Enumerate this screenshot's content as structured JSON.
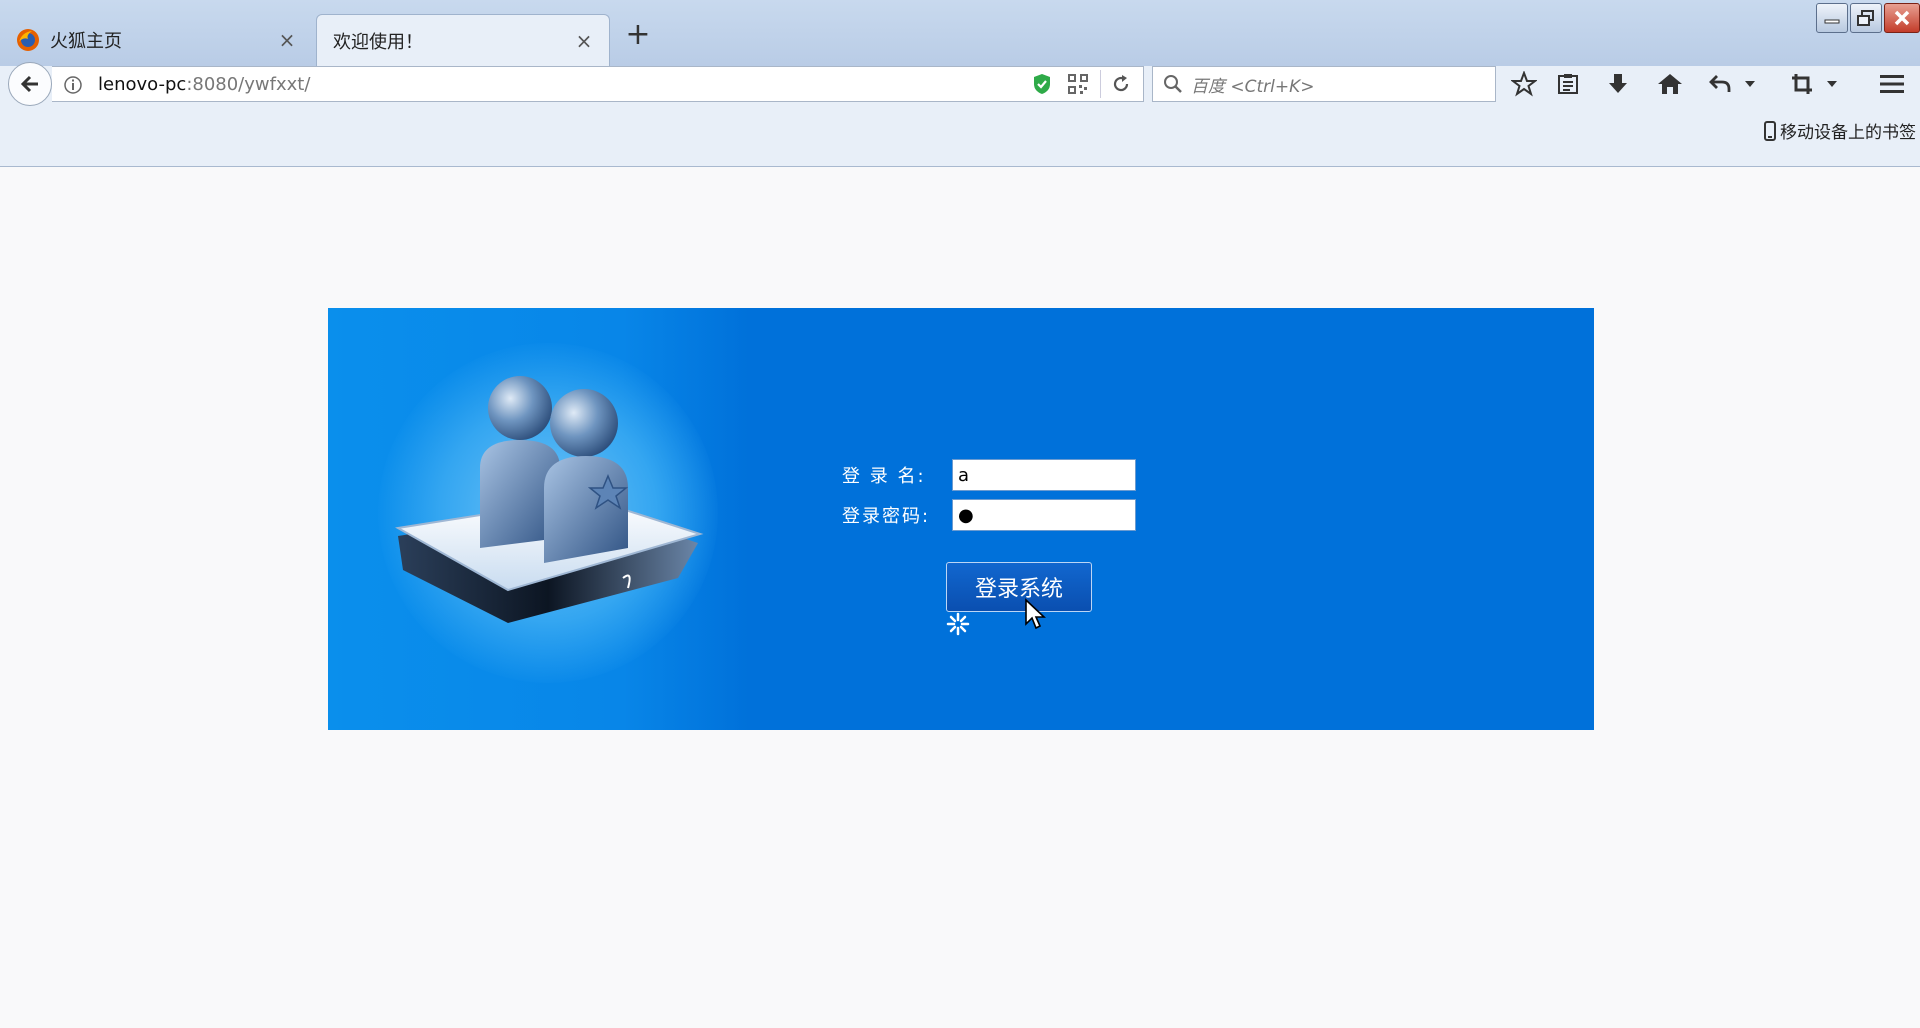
{
  "browser": {
    "tabs": [
      {
        "title": "火狐主页",
        "active": false
      },
      {
        "title": "欢迎使用！",
        "active": true
      }
    ],
    "url": {
      "host": "lenovo-pc",
      "path": ":8080/ywfxxt/"
    },
    "search_placeholder": "百度 <Ctrl+K>",
    "mobile_bookmarks": "移动设备上的书签",
    "new_tab_label": "+",
    "close_glyph": "×"
  },
  "login": {
    "username_label": "登 录 名:",
    "password_label": "登录密码:",
    "username_value": "a",
    "password_value": "●",
    "submit_label": "登录系统"
  },
  "colors": {
    "panel_bg": "#0071da",
    "panel_left": "#0a8fec",
    "button_bg": "#0a4fb0"
  }
}
